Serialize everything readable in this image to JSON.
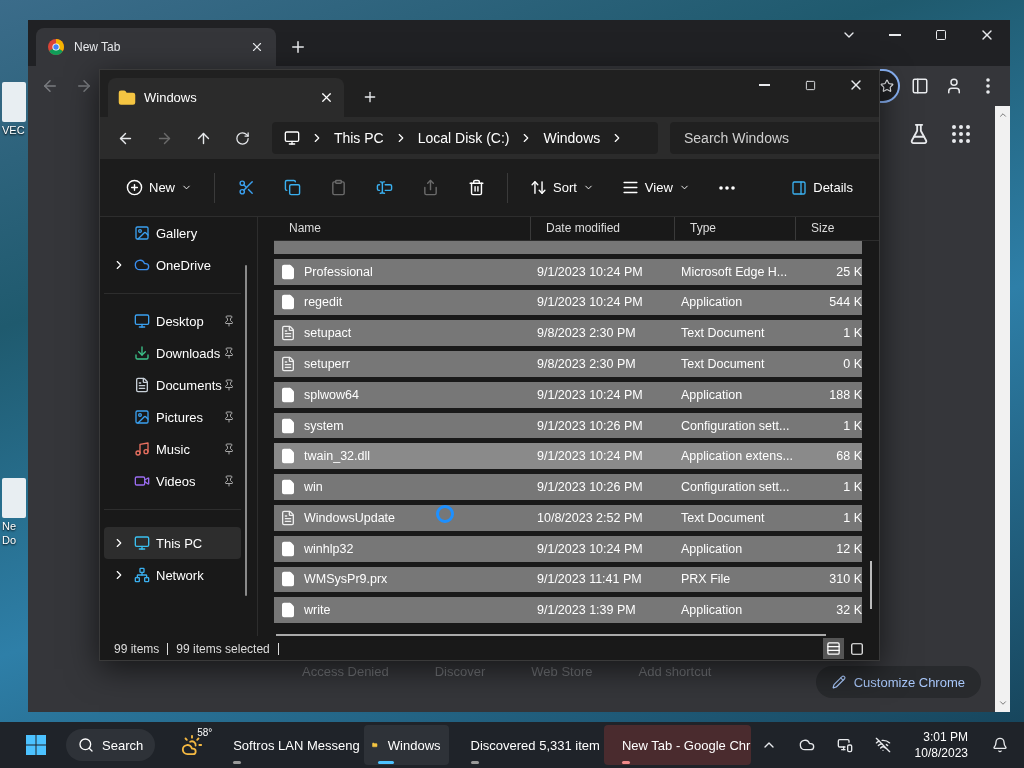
{
  "desktop_icons": [
    {
      "lines": [
        "VEC"
      ]
    },
    {
      "lines": [
        "Ne",
        "Do"
      ]
    }
  ],
  "browser": {
    "tab": {
      "title": "New Tab"
    },
    "shortcuts": [
      "Access Denied",
      "Discover",
      "Web Store",
      "Add shortcut"
    ],
    "customize_button": "Customize Chrome"
  },
  "explorer": {
    "tab": {
      "title": "Windows"
    },
    "breadcrumb": [
      "This PC",
      "Local Disk (C:)",
      "Windows"
    ],
    "search": {
      "placeholder": "Search Windows"
    },
    "commands": [
      {
        "kind": "menu",
        "label": "New"
      },
      {
        "kind": "icon",
        "disabled": false
      },
      {
        "kind": "icon",
        "disabled": false
      },
      {
        "kind": "icon",
        "disabled": true
      },
      {
        "kind": "icon",
        "disabled": false
      },
      {
        "kind": "icon",
        "disabled": true
      },
      {
        "kind": "icon",
        "disabled": false
      },
      {
        "kind": "menu",
        "label": "Sort"
      },
      {
        "kind": "menu",
        "label": "View"
      },
      {
        "kind": "more"
      }
    ],
    "details_button": "Details",
    "nav_groups": [
      [
        {
          "label": "Gallery",
          "expandable": false,
          "pinned": false,
          "selected": false
        },
        {
          "label": "OneDrive",
          "expandable": true,
          "pinned": false,
          "selected": false
        }
      ],
      [
        {
          "label": "Desktop",
          "expandable": false,
          "pinned": true,
          "selected": false
        },
        {
          "label": "Downloads",
          "expandable": false,
          "pinned": true,
          "selected": false
        },
        {
          "label": "Documents",
          "expandable": false,
          "pinned": true,
          "selected": false
        },
        {
          "label": "Pictures",
          "expandable": false,
          "pinned": true,
          "selected": false
        },
        {
          "label": "Music",
          "expandable": false,
          "pinned": true,
          "selected": false
        },
        {
          "label": "Videos",
          "expandable": false,
          "pinned": true,
          "selected": false
        }
      ],
      [
        {
          "label": "This PC",
          "expandable": true,
          "pinned": false,
          "selected": true
        },
        {
          "label": "Network",
          "expandable": true,
          "pinned": false,
          "selected": false
        }
      ]
    ],
    "columns": [
      "Name",
      "Date modified",
      "Type",
      "Size"
    ],
    "rows": [
      {
        "kind": "file",
        "name": "Professional",
        "date": "9/1/2023 10:24 PM",
        "type": "Microsoft Edge H...",
        "size": "25 K",
        "selected": true,
        "hovered": false
      },
      {
        "kind": "file",
        "name": "regedit",
        "date": "9/1/2023 10:24 PM",
        "type": "Application",
        "size": "544 K",
        "selected": true,
        "hovered": false
      },
      {
        "kind": "text",
        "name": "setupact",
        "date": "9/8/2023 2:30 PM",
        "type": "Text Document",
        "size": "1 K",
        "selected": true,
        "hovered": false
      },
      {
        "kind": "text",
        "name": "setuperr",
        "date": "9/8/2023 2:30 PM",
        "type": "Text Document",
        "size": "0 K",
        "selected": true,
        "hovered": false
      },
      {
        "kind": "file",
        "name": "splwow64",
        "date": "9/1/2023 10:24 PM",
        "type": "Application",
        "size": "188 K",
        "selected": true,
        "hovered": false
      },
      {
        "kind": "file",
        "name": "system",
        "date": "9/1/2023 10:26 PM",
        "type": "Configuration sett...",
        "size": "1 K",
        "selected": true,
        "hovered": false
      },
      {
        "kind": "file",
        "name": "twain_32.dll",
        "date": "9/1/2023 10:24 PM",
        "type": "Application extens...",
        "size": "68 K",
        "selected": true,
        "hovered": true
      },
      {
        "kind": "file",
        "name": "win",
        "date": "9/1/2023 10:26 PM",
        "type": "Configuration sett...",
        "size": "1 K",
        "selected": true,
        "hovered": false
      },
      {
        "kind": "text",
        "name": "WindowsUpdate",
        "date": "10/8/2023 2:52 PM",
        "type": "Text Document",
        "size": "1 K",
        "selected": true,
        "hovered": false
      },
      {
        "kind": "file",
        "name": "winhlp32",
        "date": "9/1/2023 10:24 PM",
        "type": "Application",
        "size": "12 K",
        "selected": true,
        "hovered": false
      },
      {
        "kind": "file",
        "name": "WMSysPr9.prx",
        "date": "9/1/2023 11:41 PM",
        "type": "PRX File",
        "size": "310 K",
        "selected": true,
        "hovered": false
      },
      {
        "kind": "file",
        "name": "write",
        "date": "9/1/2023 1:39 PM",
        "type": "Application",
        "size": "32 K",
        "selected": true,
        "hovered": false
      }
    ],
    "status": {
      "count": "99 items",
      "selection": "99 items selected"
    },
    "view_modes": [
      {
        "selected": true
      },
      {
        "selected": false
      }
    ]
  },
  "taskbar": {
    "search": "Search",
    "weather": "58°",
    "apps": [
      {
        "label": "Softros LAN Messeng",
        "active": false,
        "flashing": false,
        "running": true
      },
      {
        "label": "Windows",
        "active": true,
        "flashing": false,
        "running": true
      },
      {
        "label": "Discovered 5,331 item",
        "active": false,
        "flashing": false,
        "running": true
      },
      {
        "label": "New Tab - Google Chr",
        "active": false,
        "flashing": true,
        "running": true
      }
    ],
    "time": "3:01 PM",
    "date": "10/8/2023"
  }
}
